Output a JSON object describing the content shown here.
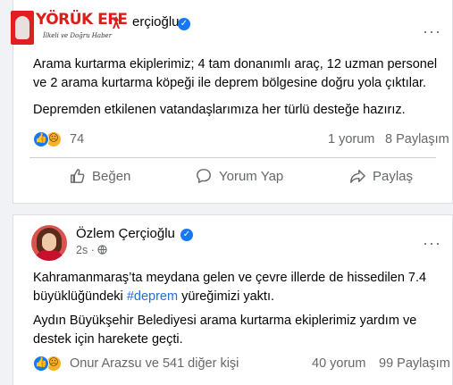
{
  "logo": {
    "name": "YÖRÜK EFE",
    "tagline": "İlkeli ve Doğru Haber"
  },
  "post1": {
    "author_partial": "erçioğlu",
    "paragraphs": [
      "Arama kurtarma ekiplerimiz; 4 tam donanımlı araç, 12 uzman personel ve 2 arama kurtarma köpeği ile deprem bölgesine doğru yola çıktılar.",
      "Depremden etkilenen vatandaşlarımıza her türlü desteğe hazırız."
    ],
    "reaction_count": "74",
    "comments": "1 yorum",
    "shares": "8 Paylaşım",
    "actions": {
      "like": "Beğen",
      "comment": "Yorum Yap",
      "share": "Paylaş"
    }
  },
  "post2": {
    "author": "Özlem Çerçioğlu",
    "time": "2s",
    "para1_before": "Kahramanmaraş’ta meydana gelen ve çevre illerde de hissedilen 7.4 büyüklüğündeki ",
    "para1_hashtag": "#deprem",
    "para1_after": " yüreğimizi yaktı.",
    "para2": "Aydın Büyükşehir Belediyesi arama kurtarma ekiplerimiz yardım ve destek için harekete geçti.",
    "reactors": "Onur Arazsu ve 541 diğer kişi",
    "comments": "40 yorum",
    "shares": "99 Paylaşım"
  },
  "colors": {
    "accent": "#1877f2",
    "hashtag": "#216fdb",
    "secondary_text": "#65676b",
    "logo_red": "#e21a1a"
  },
  "icons": [
    "like-icon",
    "sad-icon",
    "thumbs-up-icon",
    "comment-icon",
    "share-icon",
    "verified-icon",
    "globe-icon",
    "more-icon"
  ]
}
